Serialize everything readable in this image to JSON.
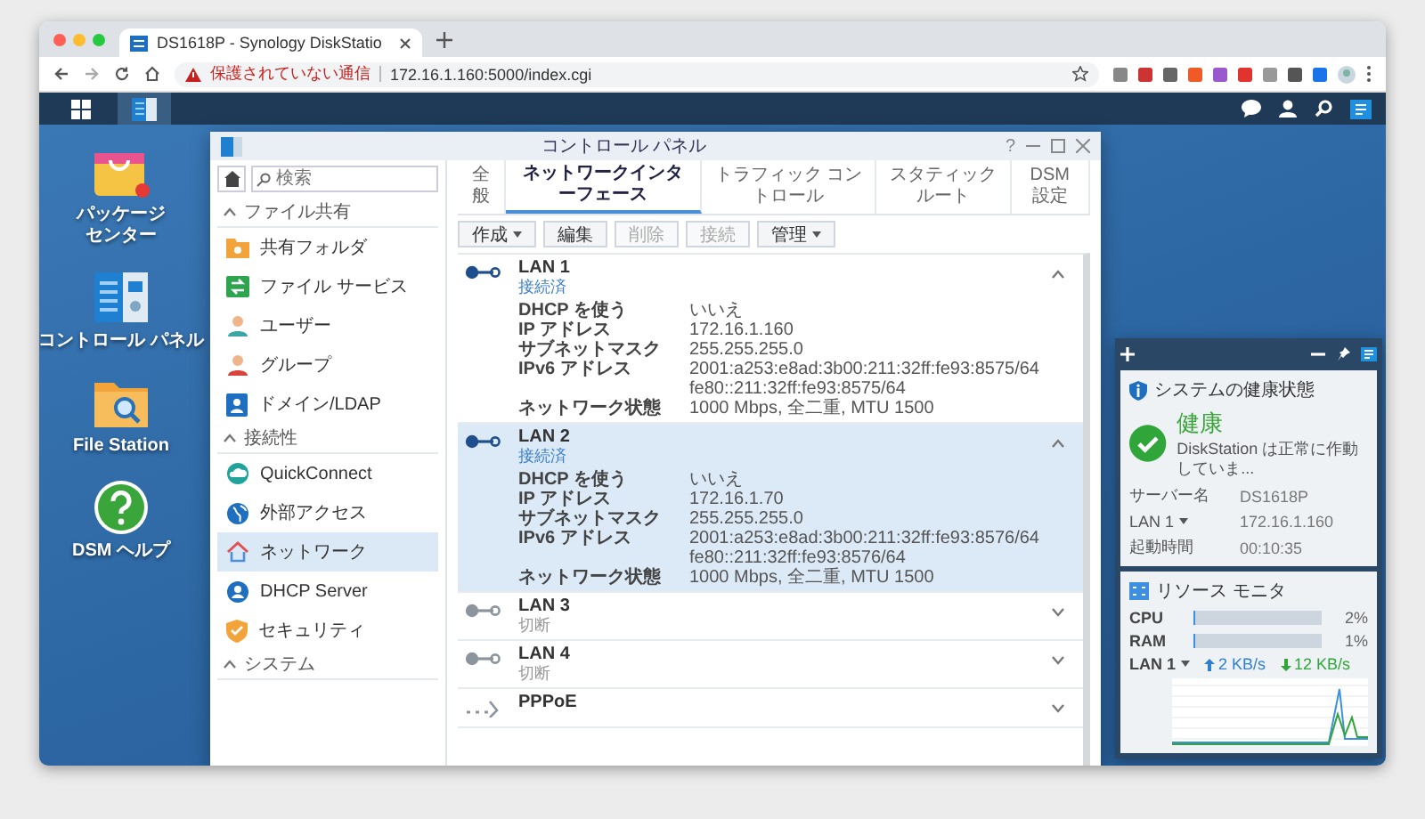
{
  "browser": {
    "tab": {
      "title": "DS1618P - Synology DiskStatio",
      "selected": true
    },
    "address": {
      "warning": "保護されていない通信",
      "url": "172.16.1.160:5000/index.cgi"
    }
  },
  "taskbar": {
    "apps": [
      {
        "kind": "main-menu",
        "selected": false
      },
      {
        "kind": "control-panel",
        "selected": true
      }
    ]
  },
  "desktop_icons": [
    {
      "label": [
        "パッケージ",
        "センター"
      ]
    },
    {
      "label": [
        "コントロール パネル"
      ]
    },
    {
      "label": [
        "File Station"
      ]
    },
    {
      "label": [
        "DSM ヘルプ"
      ]
    }
  ],
  "control_panel": {
    "title": "コントロール パネル",
    "help": "?",
    "search": {
      "placeholder": "検索"
    },
    "sidebar": [
      {
        "kind": "header",
        "label": "ファイル共有",
        "expanded": true
      },
      {
        "kind": "item",
        "label": "共有フォルダ",
        "selected": false
      },
      {
        "kind": "item",
        "label": "ファイル サービス",
        "selected": false
      },
      {
        "kind": "item",
        "label": "ユーザー",
        "selected": false
      },
      {
        "kind": "item",
        "label": "グループ",
        "selected": false
      },
      {
        "kind": "item",
        "label": "ドメイン/LDAP",
        "selected": false
      },
      {
        "kind": "header",
        "label": "接続性",
        "expanded": true
      },
      {
        "kind": "item",
        "label": "QuickConnect",
        "selected": false
      },
      {
        "kind": "item",
        "label": "外部アクセス",
        "selected": false
      },
      {
        "kind": "item",
        "label": "ネットワーク",
        "selected": true
      },
      {
        "kind": "item",
        "label": "DHCP Server",
        "selected": false
      },
      {
        "kind": "item",
        "label": "セキュリティ",
        "selected": false
      },
      {
        "kind": "header",
        "label": "システム",
        "expanded": true
      }
    ],
    "tabs": [
      {
        "label": "全般",
        "selected": false
      },
      {
        "label": "ネットワークインターフェース",
        "selected": true
      },
      {
        "label": "トラフィック コントロール",
        "selected": false
      },
      {
        "label": "スタティックルート",
        "selected": false
      },
      {
        "label": "DSM 設定",
        "selected": false
      }
    ],
    "toolbar": [
      {
        "label": "作成",
        "dropdown": true,
        "disabled": false
      },
      {
        "label": "編集",
        "dropdown": false,
        "disabled": false
      },
      {
        "label": "削除",
        "dropdown": false,
        "disabled": true
      },
      {
        "label": "接続",
        "dropdown": false,
        "disabled": true
      },
      {
        "label": "管理",
        "dropdown": true,
        "disabled": false
      }
    ],
    "interfaces": [
      {
        "kind": "ethernet",
        "name": "LAN 1",
        "status": "接続済",
        "connected": true,
        "expanded": true,
        "selected": false,
        "details": [
          {
            "label": "DHCP を使う",
            "values": [
              "いいえ"
            ]
          },
          {
            "label": "IP アドレス",
            "values": [
              "172.16.1.160"
            ]
          },
          {
            "label": "サブネットマスク",
            "values": [
              "255.255.255.0"
            ]
          },
          {
            "label": "IPv6 アドレス",
            "values": [
              "2001:a253:e8ad:3b00:211:32ff:fe93:8575/64",
              "fe80::211:32ff:fe93:8575/64"
            ]
          },
          {
            "label": "ネットワーク状態",
            "values": [
              "1000 Mbps, 全二重, MTU 1500"
            ]
          }
        ]
      },
      {
        "kind": "ethernet",
        "name": "LAN 2",
        "status": "接続済",
        "connected": true,
        "expanded": true,
        "selected": true,
        "details": [
          {
            "label": "DHCP を使う",
            "values": [
              "いいえ"
            ]
          },
          {
            "label": "IP アドレス",
            "values": [
              "172.16.1.70"
            ]
          },
          {
            "label": "サブネットマスク",
            "values": [
              "255.255.255.0"
            ]
          },
          {
            "label": "IPv6 アドレス",
            "values": [
              "2001:a253:e8ad:3b00:211:32ff:fe93:8576/64",
              "fe80::211:32ff:fe93:8576/64"
            ]
          },
          {
            "label": "ネットワーク状態",
            "values": [
              "1000 Mbps, 全二重, MTU 1500"
            ]
          }
        ]
      },
      {
        "kind": "ethernet",
        "name": "LAN 3",
        "status": "切断",
        "connected": false,
        "expanded": false,
        "selected": false
      },
      {
        "kind": "ethernet",
        "name": "LAN 4",
        "status": "切断",
        "connected": false,
        "expanded": false,
        "selected": false
      },
      {
        "kind": "pppoe",
        "name": "PPPoE",
        "connected": false,
        "expanded": false,
        "selected": false
      }
    ]
  },
  "widgets": {
    "health": {
      "title": "システムの健康状態",
      "status": "健康",
      "message": "DiskStation は正常に作動していま...",
      "rows": [
        {
          "label": "サーバー名",
          "dropdown": false,
          "value": "DS1618P"
        },
        {
          "label": "LAN 1",
          "dropdown": true,
          "value": "172.16.1.160"
        },
        {
          "label": "起動時間",
          "dropdown": false,
          "value": "00:10:35"
        }
      ]
    },
    "resource": {
      "title": "リソース モニタ",
      "meters": [
        {
          "label": "CPU",
          "level": 0.02,
          "reading": "2%"
        },
        {
          "label": "RAM",
          "level": 0.01,
          "reading": "1%"
        }
      ],
      "network": {
        "label": "LAN 1",
        "upload": "2 KB/s",
        "download": "12 KB/s"
      }
    }
  }
}
